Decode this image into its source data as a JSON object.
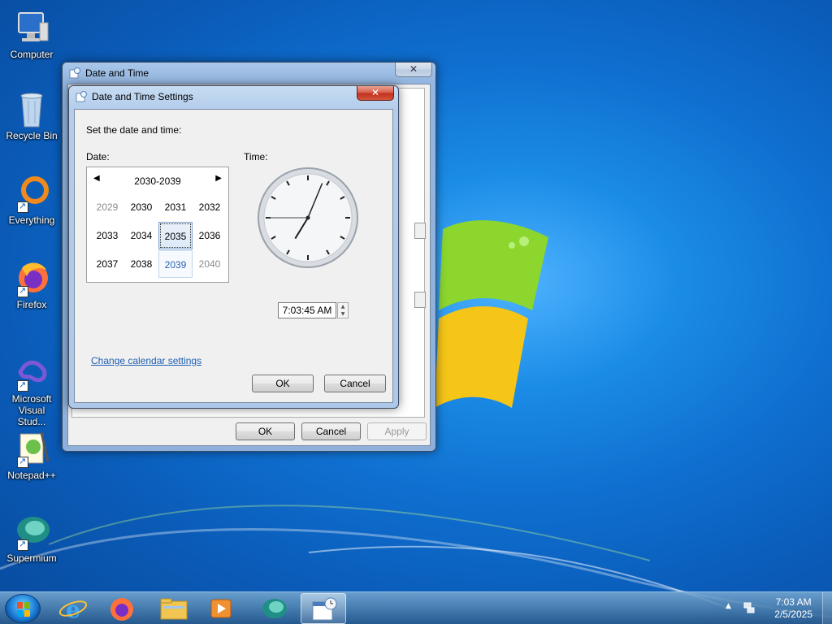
{
  "desktop": {
    "icons": [
      {
        "label": "Computer",
        "icon": "computer-icon"
      },
      {
        "label": "Recycle Bin",
        "icon": "recycle-bin-icon"
      },
      {
        "label": "Everything",
        "icon": "everything-icon"
      },
      {
        "label": "Firefox",
        "icon": "firefox-icon"
      },
      {
        "label": "Microsoft Visual Stud...",
        "icon": "visual-studio-icon"
      },
      {
        "label": "Notepad++",
        "icon": "notepad-plus-plus-icon"
      },
      {
        "label": "Supermium",
        "icon": "supermium-icon"
      }
    ]
  },
  "date_time_window": {
    "title": "Date and Time",
    "close_label": "✕",
    "ok_label": "OK",
    "cancel_label": "Cancel",
    "apply_label": "Apply"
  },
  "settings_dialog": {
    "title": "Date and Time Settings",
    "close_label": "✕",
    "instruction": "Set the date and time:",
    "date_label": "Date:",
    "time_label": "Time:",
    "calendar": {
      "header": "2030-2039",
      "prev_arrow": "◀",
      "next_arrow": "▶",
      "years": [
        "2029",
        "2030",
        "2031",
        "2032",
        "2033",
        "2034",
        "2035",
        "2036",
        "2037",
        "2038",
        "2039",
        "2040"
      ],
      "selected": "2035",
      "highlighted": "2039"
    },
    "clock": {
      "hour": 7,
      "minute": 3,
      "second": 45
    },
    "time_value": "7:03:45 AM",
    "change_calendar_link": "Change calendar settings",
    "ok_label": "OK",
    "cancel_label": "Cancel"
  },
  "taskbar": {
    "items": [
      "start-orb",
      "internet-explorer-icon",
      "firefox-icon",
      "file-explorer-icon",
      "media-player-icon",
      "supermium-icon",
      "date-time-icon"
    ],
    "tray_arrow": "▲",
    "time": "7:03 AM",
    "date": "2/5/2025"
  },
  "colors": {
    "desktop_blue": "#0f6fd0",
    "link_blue": "#1f5fb4",
    "close_red": "#c2301b"
  }
}
